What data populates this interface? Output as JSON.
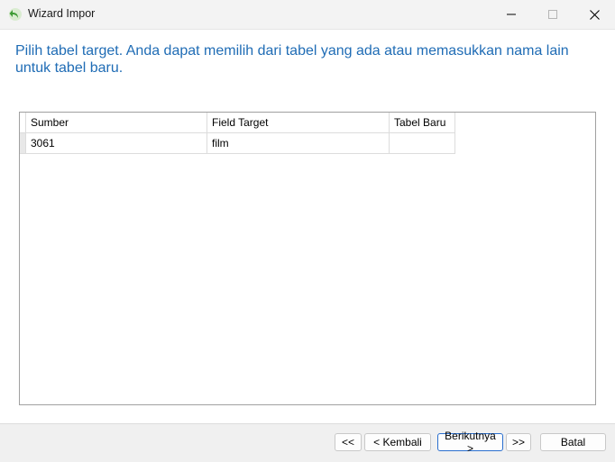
{
  "window": {
    "title": "Wizard Impor",
    "icon": "import-wizard-icon"
  },
  "instruction": "Pilih tabel target. Anda dapat memilih dari tabel yang ada atau memasukkan nama lain untuk tabel baru.",
  "grid": {
    "columns": [
      "Sumber",
      "Field Target",
      "Tabel Baru"
    ],
    "rows": [
      {
        "source": "3061",
        "target": "film",
        "new_table": ""
      }
    ]
  },
  "buttons": {
    "first": "<<",
    "back": "< Kembali",
    "next": "Berikutnya >",
    "last": ">>",
    "cancel": "Batal"
  },
  "colors": {
    "instruction": "#1f6cb5",
    "primary_border": "#2a6fcf"
  }
}
